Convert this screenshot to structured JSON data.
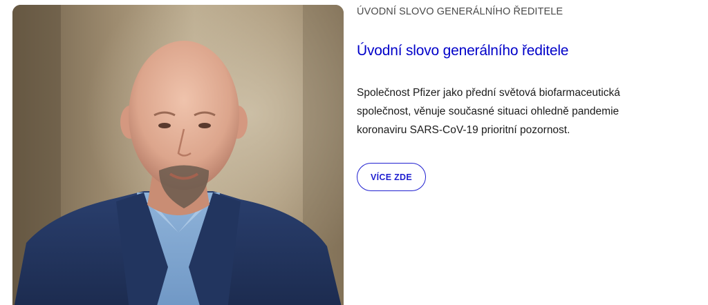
{
  "section": {
    "eyebrow": "ÚVODNÍ SLOVO GENERÁLNÍHO ŘEDITELE",
    "title": "Úvodní slovo generálního ředitele",
    "body": "Společnost Pfizer jako přední světová biofarmaceutická společnost, věnuje současné situaci ohledně pandemie koronaviru SARS-CoV-19 prioritní pozornost.",
    "button_label": "VÍCE ZDE"
  },
  "colors": {
    "accent": "#0000c9",
    "button_border": "#1f1fd0",
    "eyebrow": "#4a4a4a",
    "body_text": "#1a1a1a"
  },
  "image": {
    "subject": "portrait-photo"
  }
}
